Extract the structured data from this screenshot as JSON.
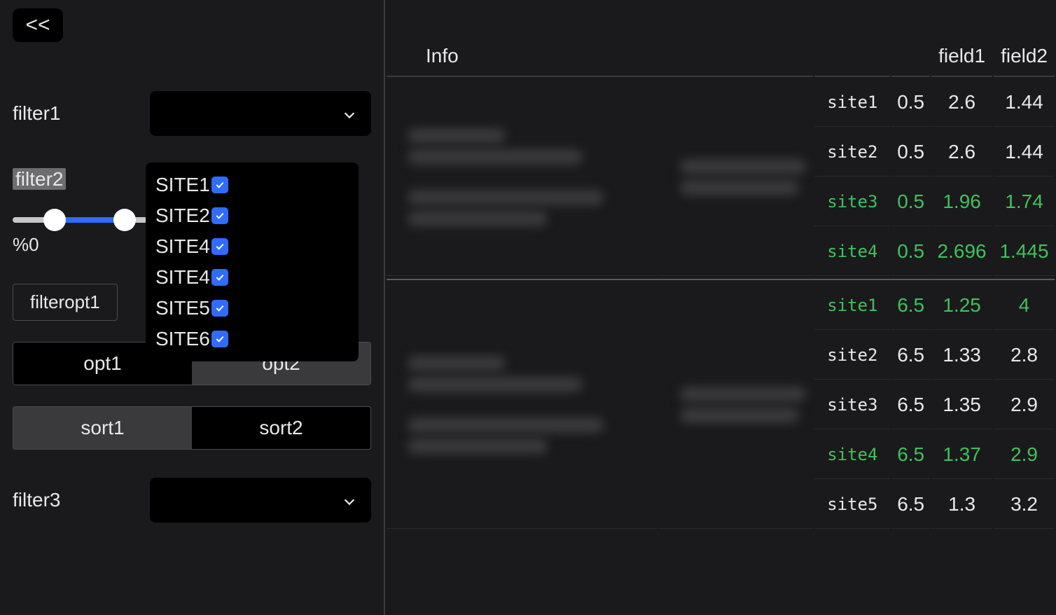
{
  "sidebar": {
    "collapse_label": "<<",
    "filter1": {
      "label": "filter1"
    },
    "filter2": {
      "label": "filter2",
      "slider_min_label": "%0"
    },
    "dropdown": {
      "items": [
        {
          "label": "SITE1",
          "checked": true
        },
        {
          "label": "SITE2",
          "checked": true
        },
        {
          "label": "SITE4",
          "checked": true
        },
        {
          "label": "SITE4",
          "checked": true
        },
        {
          "label": "SITE5",
          "checked": true
        },
        {
          "label": "SITE6",
          "checked": true
        }
      ]
    },
    "chip": {
      "label": "filteropt1"
    },
    "opt_toggle": {
      "a": "opt1",
      "b": "opt2",
      "active": "b"
    },
    "sort_toggle": {
      "a": "sort1",
      "b": "sort2",
      "active": "a"
    },
    "filter3": {
      "label": "filter3"
    }
  },
  "table": {
    "headers": {
      "info": "Info",
      "field1": "field1",
      "field2": "field2"
    },
    "groups": [
      {
        "rows": [
          {
            "site": "site1",
            "v0": "0.5",
            "field1": "2.6",
            "field2": "1.44",
            "hl": false
          },
          {
            "site": "site2",
            "v0": "0.5",
            "field1": "2.6",
            "field2": "1.44",
            "hl": false
          },
          {
            "site": "site3",
            "v0": "0.5",
            "field1": "1.96",
            "field2": "1.74",
            "hl": true
          },
          {
            "site": "site4",
            "v0": "0.5",
            "field1": "2.696",
            "field2": "1.445",
            "hl": true
          }
        ]
      },
      {
        "rows": [
          {
            "site": "site1",
            "v0": "6.5",
            "field1": "1.25",
            "field2": "4",
            "hl": true
          },
          {
            "site": "site2",
            "v0": "6.5",
            "field1": "1.33",
            "field2": "2.8",
            "hl": false
          },
          {
            "site": "site3",
            "v0": "6.5",
            "field1": "1.35",
            "field2": "2.9",
            "hl": false
          },
          {
            "site": "site4",
            "v0": "6.5",
            "field1": "1.37",
            "field2": "2.9",
            "hl": true
          },
          {
            "site": "site5",
            "v0": "6.5",
            "field1": "1.3",
            "field2": "3.2",
            "hl": false
          }
        ]
      }
    ]
  }
}
